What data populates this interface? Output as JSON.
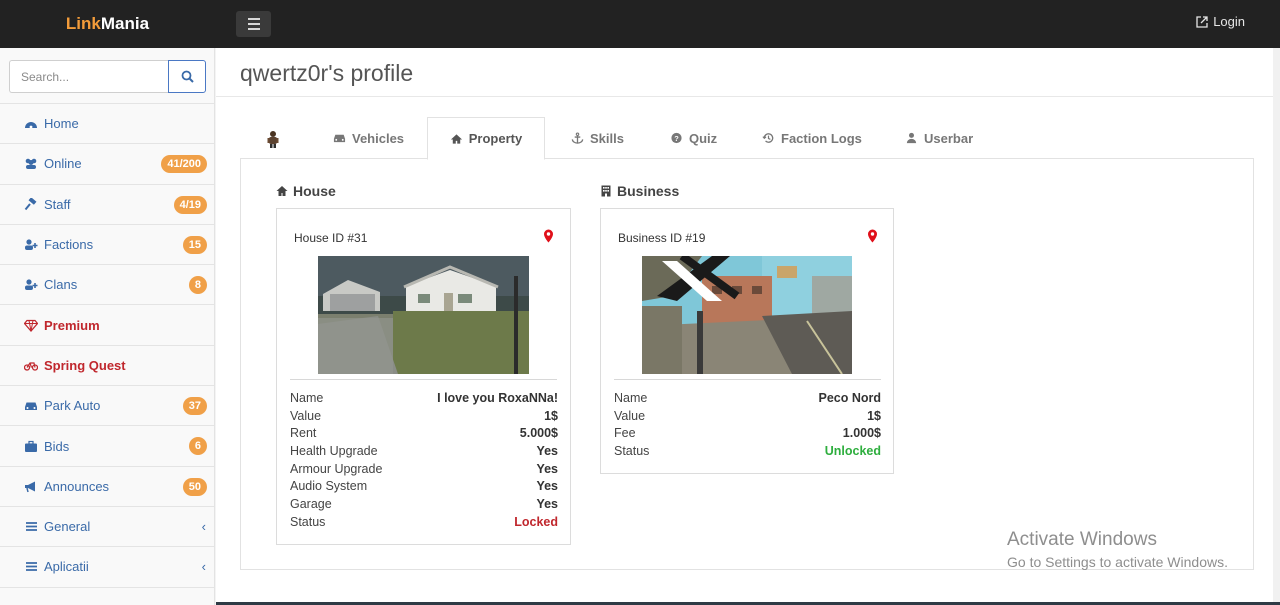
{
  "brand": {
    "part1": "Link",
    "part2": "Mania"
  },
  "topbar": {
    "login_label": "Login"
  },
  "search": {
    "placeholder": "Search..."
  },
  "sidebar": {
    "items": [
      {
        "label": "Home",
        "icon": "dashboard-icon"
      },
      {
        "label": "Online",
        "icon": "users-icon",
        "badge": "41/200"
      },
      {
        "label": "Staff",
        "icon": "gavel-icon",
        "badge": "4/19"
      },
      {
        "label": "Factions",
        "icon": "user-plus-icon",
        "badge": "15"
      },
      {
        "label": "Clans",
        "icon": "user-plus-icon",
        "badge": "8"
      },
      {
        "label": "Premium",
        "icon": "diamond-icon"
      },
      {
        "label": "Spring Quest",
        "icon": "bicycle-icon"
      },
      {
        "label": "Park Auto",
        "icon": "car-icon",
        "badge": "37"
      },
      {
        "label": "Bids",
        "icon": "briefcase-icon",
        "badge": "6"
      },
      {
        "label": "Announces",
        "icon": "bullhorn-icon",
        "badge": "50"
      },
      {
        "label": "General",
        "icon": "list-icon",
        "chevron": "‹"
      },
      {
        "label": "Aplicatii",
        "icon": "list-icon",
        "chevron": "‹"
      }
    ]
  },
  "page": {
    "title": "qwertz0r's profile"
  },
  "tabs": [
    {
      "label": "Vehicles",
      "icon": "car-icon"
    },
    {
      "label": "Property",
      "icon": "home-icon",
      "active": true
    },
    {
      "label": "Skills",
      "icon": "anchor-icon"
    },
    {
      "label": "Quiz",
      "icon": "question-icon"
    },
    {
      "label": "Faction Logs",
      "icon": "history-icon"
    },
    {
      "label": "Userbar",
      "icon": "user-icon"
    }
  ],
  "house": {
    "section_title": "House",
    "card_title": "House ID #31",
    "rows": [
      {
        "key": "Name",
        "value": "I love you RoxaNNa!"
      },
      {
        "key": "Value",
        "value": "1$"
      },
      {
        "key": "Rent",
        "value": "5.000$"
      },
      {
        "key": "Health Upgrade",
        "value": "Yes"
      },
      {
        "key": "Armour Upgrade",
        "value": "Yes"
      },
      {
        "key": "Audio System",
        "value": "Yes"
      },
      {
        "key": "Garage",
        "value": "Yes"
      },
      {
        "key": "Status",
        "value": "Locked"
      }
    ]
  },
  "business": {
    "section_title": "Business",
    "card_title": "Business ID #19",
    "rows": [
      {
        "key": "Name",
        "value": "Peco Nord"
      },
      {
        "key": "Value",
        "value": "1$"
      },
      {
        "key": "Fee",
        "value": "1.000$"
      },
      {
        "key": "Status",
        "value": "Unlocked"
      }
    ]
  },
  "colors": {
    "brand_orange": "#f39c3a",
    "nav_blue": "#3a6aa8",
    "locked_red": "#c0272d",
    "unlocked_green": "#2eae3e",
    "badge_orange": "#f0a048"
  },
  "watermark": {
    "line1": "Activate Windows",
    "line2": "Go to Settings to activate Windows."
  }
}
